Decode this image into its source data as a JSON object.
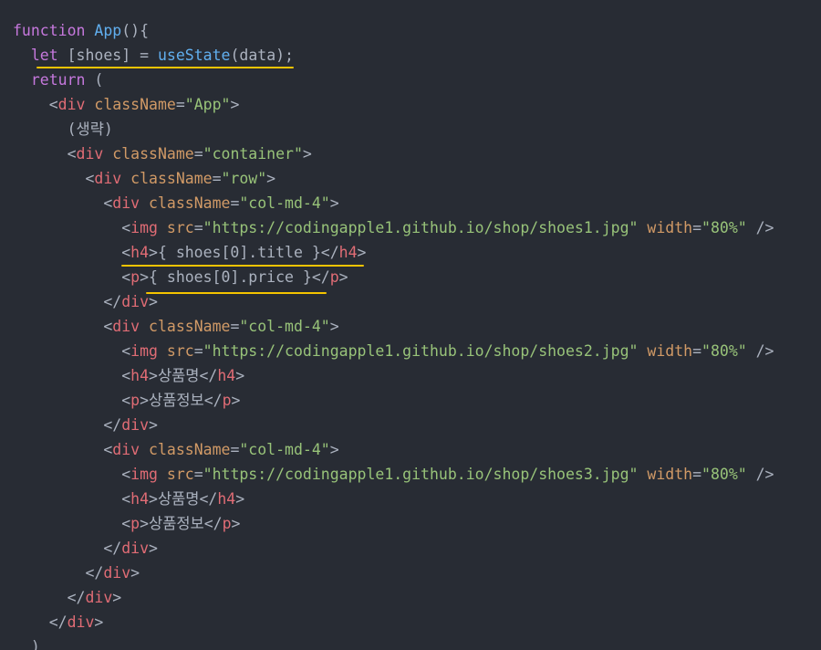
{
  "colors": {
    "background": "#282c34",
    "keyword": "#c678dd",
    "function": "#61afef",
    "tag": "#e06c75",
    "attribute": "#d19a66",
    "string": "#98c379",
    "text": "#abb2bf",
    "highlight_underline": "#f5c400"
  },
  "lines": [
    [
      [
        "kw",
        "function"
      ],
      [
        "txt",
        " "
      ],
      [
        "fn",
        "App"
      ],
      [
        "txt",
        "(){"
      ]
    ],
    [
      [
        "txt",
        "  "
      ],
      [
        "kw",
        "let"
      ],
      [
        "txt",
        " [shoes] = "
      ],
      [
        "fn",
        "useState"
      ],
      [
        "txt",
        "(data);"
      ]
    ],
    [
      [
        "txt",
        "  "
      ],
      [
        "kw",
        "return"
      ],
      [
        "txt",
        " ("
      ]
    ],
    [
      [
        "txt",
        "    <"
      ],
      [
        "tag",
        "div"
      ],
      [
        "txt",
        " "
      ],
      [
        "attr",
        "className"
      ],
      [
        "txt",
        "="
      ],
      [
        "str",
        "\"App\""
      ],
      [
        "txt",
        ">"
      ]
    ],
    [
      [
        "txt",
        "      (생략)"
      ]
    ],
    [
      [
        "txt",
        "      <"
      ],
      [
        "tag",
        "div"
      ],
      [
        "txt",
        " "
      ],
      [
        "attr",
        "className"
      ],
      [
        "txt",
        "="
      ],
      [
        "str",
        "\"container\""
      ],
      [
        "txt",
        ">"
      ]
    ],
    [
      [
        "txt",
        "        <"
      ],
      [
        "tag",
        "div"
      ],
      [
        "txt",
        " "
      ],
      [
        "attr",
        "className"
      ],
      [
        "txt",
        "="
      ],
      [
        "str",
        "\"row\""
      ],
      [
        "txt",
        ">"
      ]
    ],
    [
      [
        "txt",
        "          <"
      ],
      [
        "tag",
        "div"
      ],
      [
        "txt",
        " "
      ],
      [
        "attr",
        "className"
      ],
      [
        "txt",
        "="
      ],
      [
        "str",
        "\"col-md-4\""
      ],
      [
        "txt",
        ">"
      ]
    ],
    [
      [
        "txt",
        "            <"
      ],
      [
        "tag",
        "img"
      ],
      [
        "txt",
        " "
      ],
      [
        "attr",
        "src"
      ],
      [
        "txt",
        "="
      ],
      [
        "str",
        "\"https://codingapple1.github.io/shop/shoes1.jpg\""
      ],
      [
        "txt",
        " "
      ],
      [
        "attr",
        "width"
      ],
      [
        "txt",
        "="
      ],
      [
        "str",
        "\"80%\""
      ],
      [
        "txt",
        " />"
      ]
    ],
    [
      [
        "txt",
        "            <"
      ],
      [
        "tag",
        "h4"
      ],
      [
        "txt",
        ">{ shoes[0].title }</"
      ],
      [
        "tag",
        "h4"
      ],
      [
        "txt",
        ">"
      ]
    ],
    [
      [
        "txt",
        "            <"
      ],
      [
        "tag",
        "p"
      ],
      [
        "txt",
        ">{ shoes[0].price }</"
      ],
      [
        "tag",
        "p"
      ],
      [
        "txt",
        ">"
      ]
    ],
    [
      [
        "txt",
        "          </"
      ],
      [
        "tag",
        "div"
      ],
      [
        "txt",
        ">"
      ]
    ],
    [
      [
        "txt",
        "          <"
      ],
      [
        "tag",
        "div"
      ],
      [
        "txt",
        " "
      ],
      [
        "attr",
        "className"
      ],
      [
        "txt",
        "="
      ],
      [
        "str",
        "\"col-md-4\""
      ],
      [
        "txt",
        ">"
      ]
    ],
    [
      [
        "txt",
        "            <"
      ],
      [
        "tag",
        "img"
      ],
      [
        "txt",
        " "
      ],
      [
        "attr",
        "src"
      ],
      [
        "txt",
        "="
      ],
      [
        "str",
        "\"https://codingapple1.github.io/shop/shoes2.jpg\""
      ],
      [
        "txt",
        " "
      ],
      [
        "attr",
        "width"
      ],
      [
        "txt",
        "="
      ],
      [
        "str",
        "\"80%\""
      ],
      [
        "txt",
        " />"
      ]
    ],
    [
      [
        "txt",
        "            <"
      ],
      [
        "tag",
        "h4"
      ],
      [
        "txt",
        ">상품명</"
      ],
      [
        "tag",
        "h4"
      ],
      [
        "txt",
        ">"
      ]
    ],
    [
      [
        "txt",
        "            <"
      ],
      [
        "tag",
        "p"
      ],
      [
        "txt",
        ">상품정보</"
      ],
      [
        "tag",
        "p"
      ],
      [
        "txt",
        ">"
      ]
    ],
    [
      [
        "txt",
        "          </"
      ],
      [
        "tag",
        "div"
      ],
      [
        "txt",
        ">"
      ]
    ],
    [
      [
        "txt",
        "          <"
      ],
      [
        "tag",
        "div"
      ],
      [
        "txt",
        " "
      ],
      [
        "attr",
        "className"
      ],
      [
        "txt",
        "="
      ],
      [
        "str",
        "\"col-md-4\""
      ],
      [
        "txt",
        ">"
      ]
    ],
    [
      [
        "txt",
        "            <"
      ],
      [
        "tag",
        "img"
      ],
      [
        "txt",
        " "
      ],
      [
        "attr",
        "src"
      ],
      [
        "txt",
        "="
      ],
      [
        "str",
        "\"https://codingapple1.github.io/shop/shoes3.jpg\""
      ],
      [
        "txt",
        " "
      ],
      [
        "attr",
        "width"
      ],
      [
        "txt",
        "="
      ],
      [
        "str",
        "\"80%\""
      ],
      [
        "txt",
        " />"
      ]
    ],
    [
      [
        "txt",
        "            <"
      ],
      [
        "tag",
        "h4"
      ],
      [
        "txt",
        ">상품명</"
      ],
      [
        "tag",
        "h4"
      ],
      [
        "txt",
        ">"
      ]
    ],
    [
      [
        "txt",
        "            <"
      ],
      [
        "tag",
        "p"
      ],
      [
        "txt",
        ">상품정보</"
      ],
      [
        "tag",
        "p"
      ],
      [
        "txt",
        ">"
      ]
    ],
    [
      [
        "txt",
        "          </"
      ],
      [
        "tag",
        "div"
      ],
      [
        "txt",
        ">"
      ]
    ],
    [
      [
        "txt",
        "        </"
      ],
      [
        "tag",
        "div"
      ],
      [
        "txt",
        ">"
      ]
    ],
    [
      [
        "txt",
        "      </"
      ],
      [
        "tag",
        "div"
      ],
      [
        "txt",
        ">"
      ]
    ],
    [
      [
        "txt",
        "    </"
      ],
      [
        "tag",
        "div"
      ],
      [
        "txt",
        ">"
      ]
    ],
    [
      [
        "txt",
        "  )"
      ]
    ]
  ]
}
